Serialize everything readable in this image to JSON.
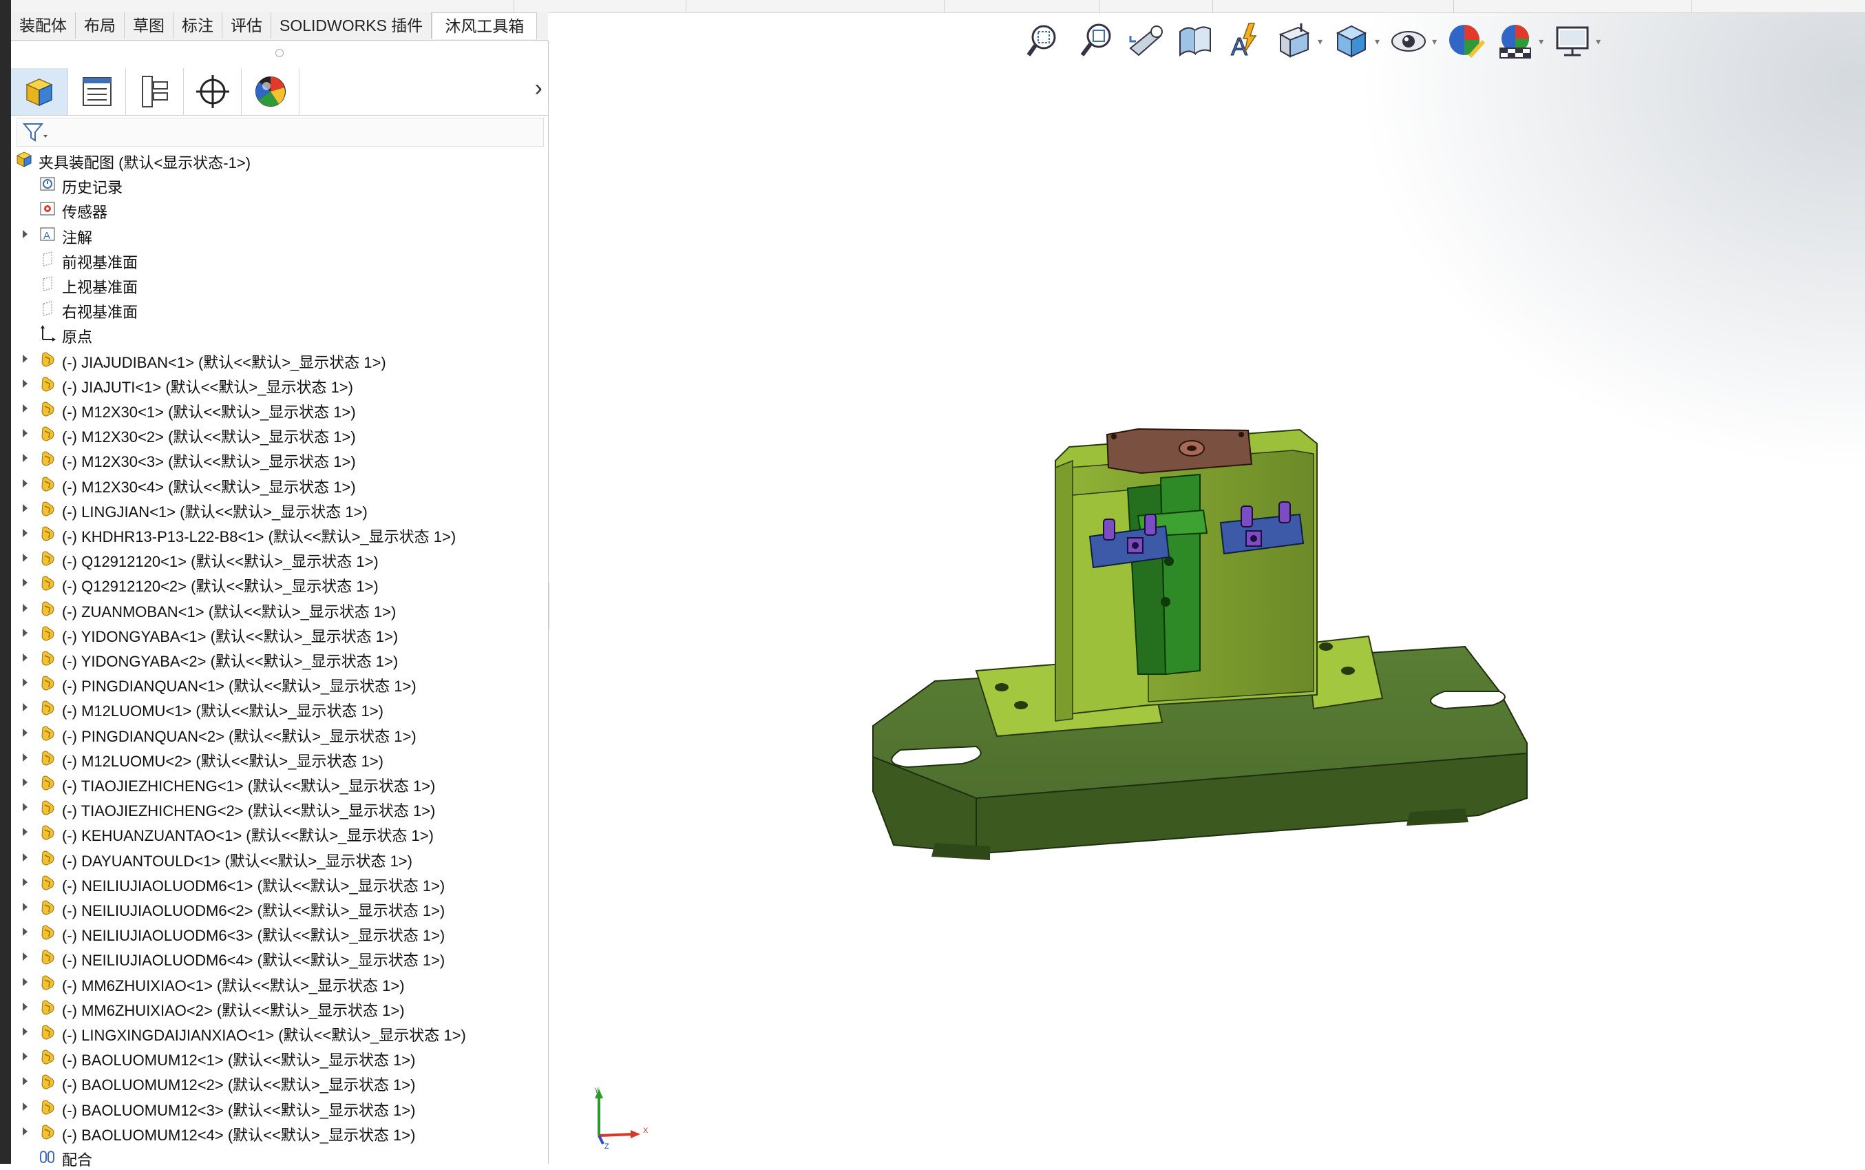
{
  "command_manager": {
    "tabs": [
      "装配体",
      "布局",
      "草图",
      "标注",
      "评估",
      "SOLIDWORKS 插件",
      "沐风工具箱"
    ],
    "active_tab": "沐风工具箱"
  },
  "feature_manager": {
    "tab_icons": [
      "featuremanager-tree-icon",
      "propertymanager-icon",
      "configurationmanager-icon",
      "dimxpert-icon",
      "display-manager-icon"
    ],
    "more_symbol": "›",
    "filter_icon": "filter-icon",
    "root": "夹具装配图  (默认<显示状态-1>)",
    "folders": [
      {
        "label": "历史记录",
        "icon": "history-icon",
        "expandable": false
      },
      {
        "label": "传感器",
        "icon": "sensor-icon",
        "expandable": false
      },
      {
        "label": "注解",
        "icon": "annotation-icon",
        "expandable": true
      },
      {
        "label": "前视基准面",
        "icon": "plane-icon",
        "expandable": false
      },
      {
        "label": "上视基准面",
        "icon": "plane-icon",
        "expandable": false
      },
      {
        "label": "右视基准面",
        "icon": "plane-icon",
        "expandable": false
      },
      {
        "label": "原点",
        "icon": "origin-icon",
        "expandable": false
      }
    ],
    "components": [
      "(-) JIAJUDIBAN<1> (默认<<默认>_显示状态 1>)",
      "(-) JIAJUTI<1> (默认<<默认>_显示状态 1>)",
      "(-) M12X30<1> (默认<<默认>_显示状态 1>)",
      "(-) M12X30<2> (默认<<默认>_显示状态 1>)",
      "(-) M12X30<3> (默认<<默认>_显示状态 1>)",
      "(-) M12X30<4> (默认<<默认>_显示状态 1>)",
      "(-) LINGJIAN<1> (默认<<默认>_显示状态 1>)",
      "(-) KHDHR13-P13-L22-B8<1> (默认<<默认>_显示状态 1>)",
      "(-) Q12912120<1> (默认<<默认>_显示状态 1>)",
      "(-) Q12912120<2> (默认<<默认>_显示状态 1>)",
      "(-) ZUANMOBAN<1> (默认<<默认>_显示状态 1>)",
      "(-) YIDONGYABA<1> (默认<<默认>_显示状态 1>)",
      "(-) YIDONGYABA<2> (默认<<默认>_显示状态 1>)",
      "(-) PINGDIANQUAN<1> (默认<<默认>_显示状态 1>)",
      "(-) M12LUOMU<1> (默认<<默认>_显示状态 1>)",
      "(-) PINGDIANQUAN<2> (默认<<默认>_显示状态 1>)",
      "(-) M12LUOMU<2> (默认<<默认>_显示状态 1>)",
      "(-) TIAOJIEZHICHENG<1> (默认<<默认>_显示状态 1>)",
      "(-) TIAOJIEZHICHENG<2> (默认<<默认>_显示状态 1>)",
      "(-) KEHUANZUANTAO<1> (默认<<默认>_显示状态 1>)",
      "(-) DAYUANTOULD<1> (默认<<默认>_显示状态 1>)",
      "(-) NEILIUJIAOLUODM6<1> (默认<<默认>_显示状态 1>)",
      "(-) NEILIUJIAOLUODM6<2> (默认<<默认>_显示状态 1>)",
      "(-) NEILIUJIAOLUODM6<3> (默认<<默认>_显示状态 1>)",
      "(-) NEILIUJIAOLUODM6<4> (默认<<默认>_显示状态 1>)",
      "(-) MM6ZHUIXIAO<1> (默认<<默认>_显示状态 1>)",
      "(-) MM6ZHUIXIAO<2> (默认<<默认>_显示状态 1>)",
      "(-) LINGXINGDAIJIANXIAO<1> (默认<<默认>_显示状态 1>)",
      "(-) BAOLUOMUM12<1> (默认<<默认>_显示状态 1>)",
      "(-) BAOLUOMUM12<2> (默认<<默认>_显示状态 1>)",
      "(-) BAOLUOMUM12<3> (默认<<默认>_显示状态 1>)",
      "(-) BAOLUOMUM12<4> (默认<<默认>_显示状态 1>)"
    ],
    "mates": "配合"
  },
  "heads_up_toolbar": [
    {
      "name": "zoom-to-fit-icon",
      "dropdown": false
    },
    {
      "name": "zoom-to-area-icon",
      "dropdown": false
    },
    {
      "name": "previous-view-icon",
      "dropdown": false
    },
    {
      "name": "section-view-icon",
      "dropdown": false
    },
    {
      "name": "dynamic-annotation-views-icon",
      "dropdown": false
    },
    {
      "name": "view-orientation-icon",
      "dropdown": true
    },
    {
      "name": "display-style-icon",
      "dropdown": true
    },
    {
      "name": "hide-show-items-icon",
      "dropdown": true
    },
    {
      "name": "edit-appearance-icon",
      "dropdown": false
    },
    {
      "name": "apply-scene-icon",
      "dropdown": true
    },
    {
      "name": "view-settings-icon",
      "dropdown": true
    }
  ],
  "triad": {
    "y": "Y",
    "x": "X",
    "z": "Z"
  },
  "colors": {
    "base_plate": "#4a6a2c",
    "upright": "#82a232",
    "column": "#2e8a26",
    "drill_plate": "#7a5040",
    "clamp": "#3c5aa8",
    "bolt": "#7a4ec0",
    "assembly_icon": "#f2c230",
    "accent": "#3d6fb6"
  }
}
